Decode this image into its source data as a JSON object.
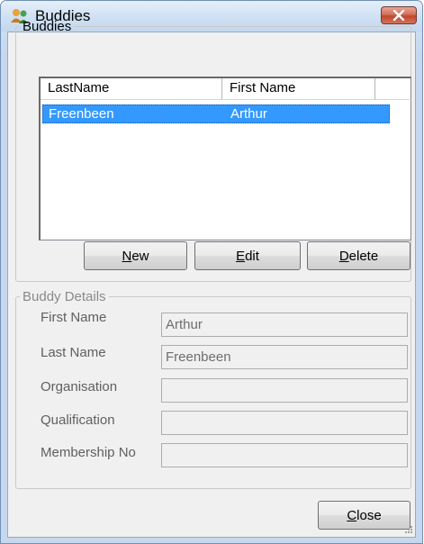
{
  "window": {
    "title": "Buddies",
    "accent_color": "#3399ff",
    "close_color": "#c0462d"
  },
  "buddies_group": {
    "legend": "Buddies",
    "columns": [
      "LastName",
      "First Name"
    ],
    "rows": [
      {
        "last_name": "Freenbeen",
        "first_name": "Arthur",
        "selected": true
      }
    ],
    "buttons": {
      "new_mnemonic": "N",
      "new_rest": "ew",
      "edit_mnemonic": "E",
      "edit_rest": "dit",
      "delete_mnemonic": "D",
      "delete_rest": "elete"
    }
  },
  "details_group": {
    "legend": "Buddy Details",
    "fields": [
      {
        "label": "First Name",
        "value": "Arthur"
      },
      {
        "label": "Last Name",
        "value": "Freenbeen"
      },
      {
        "label": "Organisation",
        "value": ""
      },
      {
        "label": "Qualification",
        "value": ""
      },
      {
        "label": "Membership No",
        "value": ""
      }
    ]
  },
  "footer": {
    "close_mnemonic": "C",
    "close_rest": "lose"
  },
  "icons": [
    "buddies-app-icon",
    "window-close-icon",
    "resize-grip-icon"
  ]
}
